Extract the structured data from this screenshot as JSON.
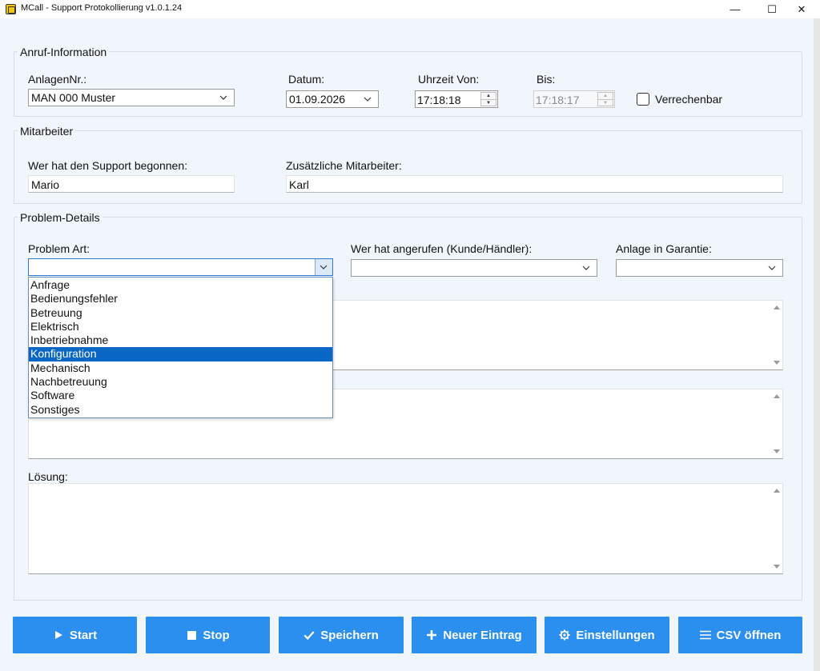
{
  "window": {
    "title": "MCall - Support Protokollierung  v1.0.1.24",
    "minimize_glyph": "—",
    "maximize_glyph": "☐",
    "close_glyph": "✕"
  },
  "anruf": {
    "legend": "Anruf-Information",
    "anlagen_label": "AnlagenNr.:",
    "anlagen_value": "MAN 000 Muster",
    "datum_label": "Datum:",
    "datum_value": "01.09.2026",
    "uhrzeit_von_label": "Uhrzeit Von:",
    "uhrzeit_von_value": "17:18:18",
    "bis_label": "Bis:",
    "bis_value": "17:18:17",
    "verrechenbar_label": "Verrechenbar",
    "verrechenbar_checked": false
  },
  "mitarbeiter": {
    "legend": "Mitarbeiter",
    "begonnen_label": "Wer hat den Support begonnen:",
    "begonnen_value": "Mario",
    "zusaetzlich_label": "Zusätzliche Mitarbeiter:",
    "zusaetzlich_value": "Karl"
  },
  "problem": {
    "legend": "Problem-Details",
    "art_label": "Problem Art:",
    "art_value": "",
    "anrufer_label": "Wer hat angerufen (Kunde/Händler):",
    "anrufer_value": "",
    "garantie_label": "Anlage in Garantie:",
    "garantie_value": "",
    "loesung_label": "Lösung:",
    "art_options": [
      "Anfrage",
      "Bedienungsfehler",
      "Betreuung",
      "Elektrisch",
      "Inbetriebnahme",
      "Konfiguration",
      "Mechanisch",
      "Nachbetreuung",
      "Software",
      "Sonstiges"
    ],
    "art_highlighted": "Konfiguration"
  },
  "buttons": {
    "start": "Start",
    "stop": "Stop",
    "speichern": "Speichern",
    "neuer_eintrag": "Neuer Eintrag",
    "einstellungen": "Einstellungen",
    "csv_oeffnen": "CSV öffnen"
  },
  "colors": {
    "button_blue": "#2b8ff0",
    "selection_blue": "#0a67c6",
    "background": "#f0f6fb"
  }
}
